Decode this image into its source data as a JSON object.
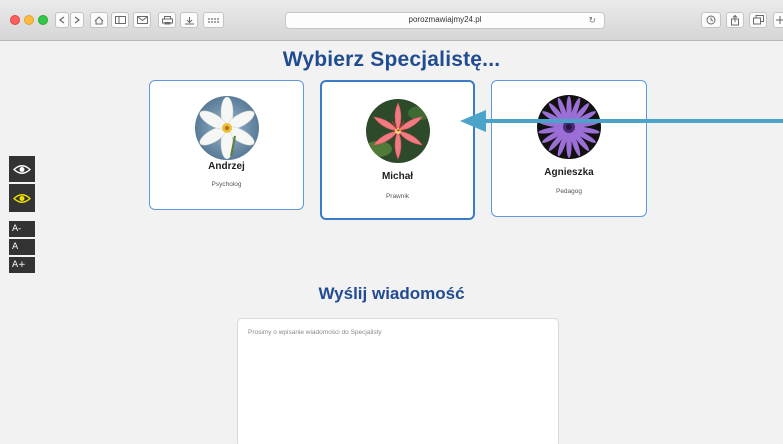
{
  "browser": {
    "url": "porozmawiajmy24.pl",
    "reload_icon": "↻"
  },
  "page": {
    "title": "Wybierz Specjalistę...",
    "specialists": [
      {
        "name": "Andrzej",
        "role": "Psycholog",
        "avatar": "white-flower"
      },
      {
        "name": "Michał",
        "role": "Prawnik",
        "avatar": "pink-lily",
        "selected": true
      },
      {
        "name": "Agnieszka",
        "role": "Pedagog",
        "avatar": "purple-daisy"
      }
    ],
    "message_section_title": "Wyślij wiadomość",
    "message_placeholder": "Prosimy o wpisanie wiadomości do Specjalisty"
  },
  "accessibility": {
    "font_decrease": "A-",
    "font_normal": "A",
    "font_increase": "A+"
  },
  "colors": {
    "heading": "#224c92",
    "card_border": "#5b9ae0",
    "arrow": "#4aa3c9"
  }
}
